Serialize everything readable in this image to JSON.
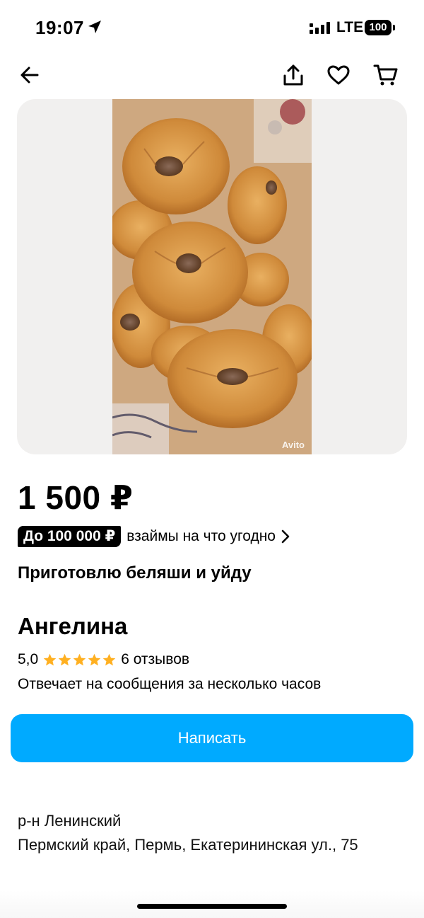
{
  "status_bar": {
    "time": "19:07",
    "network": "LTE",
    "battery": "100"
  },
  "nav": {
    "back_icon": "arrow-left-icon",
    "share_icon": "share-icon",
    "favorite_icon": "heart-icon",
    "cart_icon": "cart-icon"
  },
  "photo": {
    "description_icon": "listing-photo",
    "watermark": "Avito"
  },
  "listing": {
    "price": "1 500 ₽",
    "title": "Приготовлю беляши и уйду"
  },
  "loan": {
    "badge": "До 100 000 ₽",
    "text": "взаймы на что угодно"
  },
  "seller": {
    "name": "Ангелина",
    "rating": "5,0",
    "stars": 5,
    "reviews": "6 отзывов",
    "response_time": "Отвечает на сообщения за несколько часов"
  },
  "actions": {
    "write_label": "Написать"
  },
  "location": {
    "district": "р-н Ленинский",
    "address": "Пермский край, Пермь, Екатерининская ул., 75"
  },
  "colors": {
    "accent": "#00aaff",
    "star": "#ffb021",
    "photo_bg": "#f1f0ef"
  }
}
